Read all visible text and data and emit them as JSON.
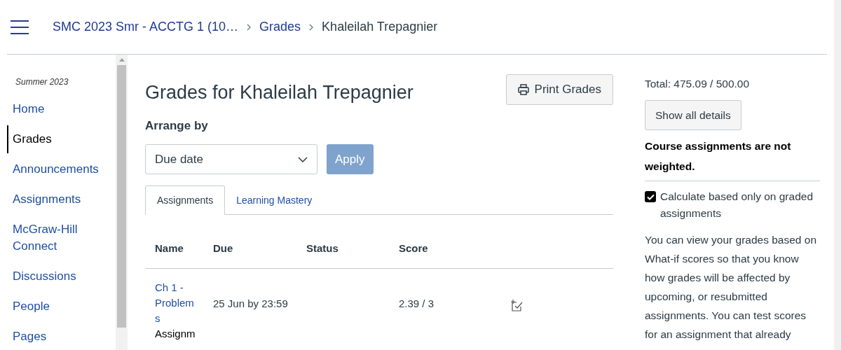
{
  "breadcrumb": [
    {
      "label": "SMC 2023 Smr - ACCTG 1 (10…",
      "link": true
    },
    {
      "label": "Grades",
      "link": true
    },
    {
      "label": "Khaleilah Trepagnier",
      "link": false
    }
  ],
  "sidebar": {
    "term": "Summer 2023",
    "items": [
      {
        "label": "Home",
        "selected": false
      },
      {
        "label": "Grades",
        "selected": true
      },
      {
        "label": "Announcements",
        "selected": false
      },
      {
        "label": "Assignments",
        "selected": false
      },
      {
        "label": "McGraw-Hill Connect",
        "selected": false
      },
      {
        "label": "Discussions",
        "selected": false
      },
      {
        "label": "People",
        "selected": false
      },
      {
        "label": "Pages",
        "selected": false
      }
    ]
  },
  "main": {
    "title": "Grades for Khaleilah Trepagnier",
    "print_button": "Print Grades",
    "arrange_label": "Arrange by",
    "arrange_value": "Due date",
    "apply_button": "Apply",
    "tabs": [
      {
        "label": "Assignments",
        "selected": true
      },
      {
        "label": "Learning Mastery",
        "selected": false
      }
    ],
    "table": {
      "columns": [
        "Name",
        "Due",
        "Status",
        "Score"
      ],
      "rows": [
        {
          "name": "Ch 1 - Problems",
          "type": "Assignm",
          "due": "25 Jun by 23:59",
          "status": "",
          "score": "2.39 / 3"
        }
      ]
    }
  },
  "summary": {
    "total": "Total: 475.09 / 500.00",
    "details_button": "Show all details",
    "weighting": "Course assignments are not weighted.",
    "calculate_label": "Calculate based only on graded assignments",
    "calculate_checked": true,
    "info": "You can view your grades based on What-if scores so that you know how grades will be affected by upcoming, or resubmitted assignments. You can test scores for an assignment that already"
  }
}
